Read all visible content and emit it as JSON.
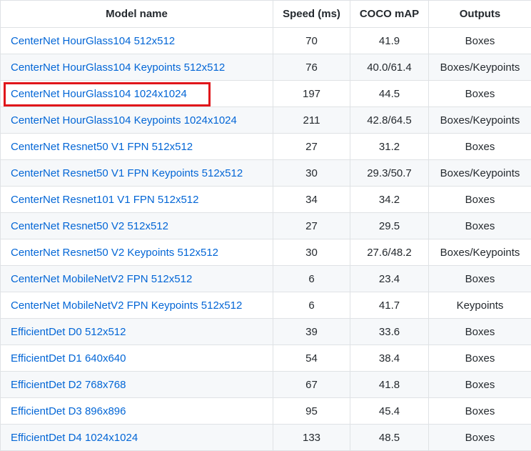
{
  "table": {
    "headers": {
      "model_name": "Model name",
      "speed": "Speed (ms)",
      "coco_map": "COCO mAP",
      "outputs": "Outputs"
    },
    "highlight_color": "#e0161b",
    "link_color": "#0366d6",
    "rows": [
      {
        "model": "CenterNet HourGlass104 512x512",
        "speed": "70",
        "map": "41.9",
        "outputs": "Boxes",
        "highlighted": false
      },
      {
        "model": "CenterNet HourGlass104 Keypoints 512x512",
        "speed": "76",
        "map": "40.0/61.4",
        "outputs": "Boxes/Keypoints",
        "highlighted": false
      },
      {
        "model": "CenterNet HourGlass104 1024x1024",
        "speed": "197",
        "map": "44.5",
        "outputs": "Boxes",
        "highlighted": true
      },
      {
        "model": "CenterNet HourGlass104 Keypoints 1024x1024",
        "speed": "211",
        "map": "42.8/64.5",
        "outputs": "Boxes/Keypoints",
        "highlighted": false
      },
      {
        "model": "CenterNet Resnet50 V1 FPN 512x512",
        "speed": "27",
        "map": "31.2",
        "outputs": "Boxes",
        "highlighted": false
      },
      {
        "model": "CenterNet Resnet50 V1 FPN Keypoints 512x512",
        "speed": "30",
        "map": "29.3/50.7",
        "outputs": "Boxes/Keypoints",
        "highlighted": false
      },
      {
        "model": "CenterNet Resnet101 V1 FPN 512x512",
        "speed": "34",
        "map": "34.2",
        "outputs": "Boxes",
        "highlighted": false
      },
      {
        "model": "CenterNet Resnet50 V2 512x512",
        "speed": "27",
        "map": "29.5",
        "outputs": "Boxes",
        "highlighted": false
      },
      {
        "model": "CenterNet Resnet50 V2 Keypoints 512x512",
        "speed": "30",
        "map": "27.6/48.2",
        "outputs": "Boxes/Keypoints",
        "highlighted": false
      },
      {
        "model": "CenterNet MobileNetV2 FPN 512x512",
        "speed": "6",
        "map": "23.4",
        "outputs": "Boxes",
        "highlighted": false
      },
      {
        "model": "CenterNet MobileNetV2 FPN Keypoints 512x512",
        "speed": "6",
        "map": "41.7",
        "outputs": "Keypoints",
        "highlighted": false
      },
      {
        "model": "EfficientDet D0 512x512",
        "speed": "39",
        "map": "33.6",
        "outputs": "Boxes",
        "highlighted": false
      },
      {
        "model": "EfficientDet D1 640x640",
        "speed": "54",
        "map": "38.4",
        "outputs": "Boxes",
        "highlighted": false
      },
      {
        "model": "EfficientDet D2 768x768",
        "speed": "67",
        "map": "41.8",
        "outputs": "Boxes",
        "highlighted": false
      },
      {
        "model": "EfficientDet D3 896x896",
        "speed": "95",
        "map": "45.4",
        "outputs": "Boxes",
        "highlighted": false
      },
      {
        "model": "EfficientDet D4 1024x1024",
        "speed": "133",
        "map": "48.5",
        "outputs": "Boxes",
        "highlighted": false
      }
    ]
  }
}
